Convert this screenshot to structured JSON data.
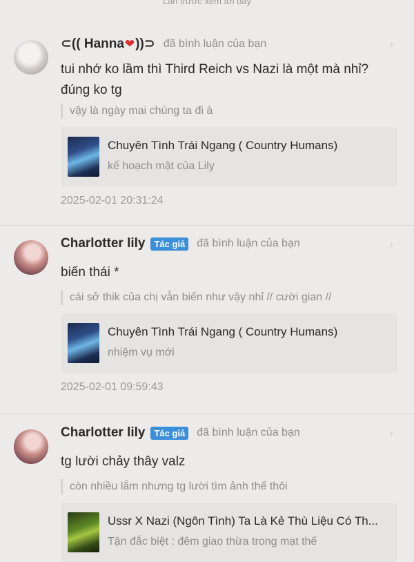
{
  "top_note": "Lần trước xem tới đây",
  "comments": [
    {
      "username": "⊂(( Hanna",
      "username_suffix": "))⊃",
      "heart": "❤",
      "author_badge": "",
      "action": "đã bình luận của bạn",
      "text_line1": "tui nhớ ko lầm thì Third Reich vs Nazi là một mà nhỉ?",
      "text_line2": "đúng ko tg",
      "quote": "vậy là ngày mai chúng ta đi à",
      "story_title": "Chuyên Tình Trái Ngang ( Country Humans)",
      "story_chapter": "kế hoạch mật của Lily",
      "timestamp": "2025-02-01 20:31:24"
    },
    {
      "username": "Charlotter lily",
      "author_badge": "Tác giả",
      "action": "đã bình luận của bạn",
      "text_line1": "biến thái *",
      "quote": "cái sở thik của chị vẫn biến như vậy nhỉ // cười gian //",
      "story_title": "Chuyên Tình Trái Ngang ( Country Humans)",
      "story_chapter": "nhiệm vụ mới",
      "timestamp": "2025-02-01 09:59:43"
    },
    {
      "username": "Charlotter lily",
      "author_badge": "Tác giả",
      "action": "đã bình luận của bạn",
      "text_line1": "tg lười chảy thây valz",
      "quote": "còn nhiều lắm nhưng tg lười tìm ảnh thế thôi",
      "story_title": "Ussr X Nazi (Ngôn Tình) Ta Là Kẻ Thù Liệu Có Th...",
      "story_chapter": "Tận đắc biệt : đêm giao thừa trong mạt thế"
    }
  ],
  "icons": {
    "chevron": "chevron-right-icon",
    "heart": "heart-icon"
  },
  "colors": {
    "badge": "#3b8fd8",
    "heart": "#e12c2c",
    "background": "#ecebea"
  }
}
